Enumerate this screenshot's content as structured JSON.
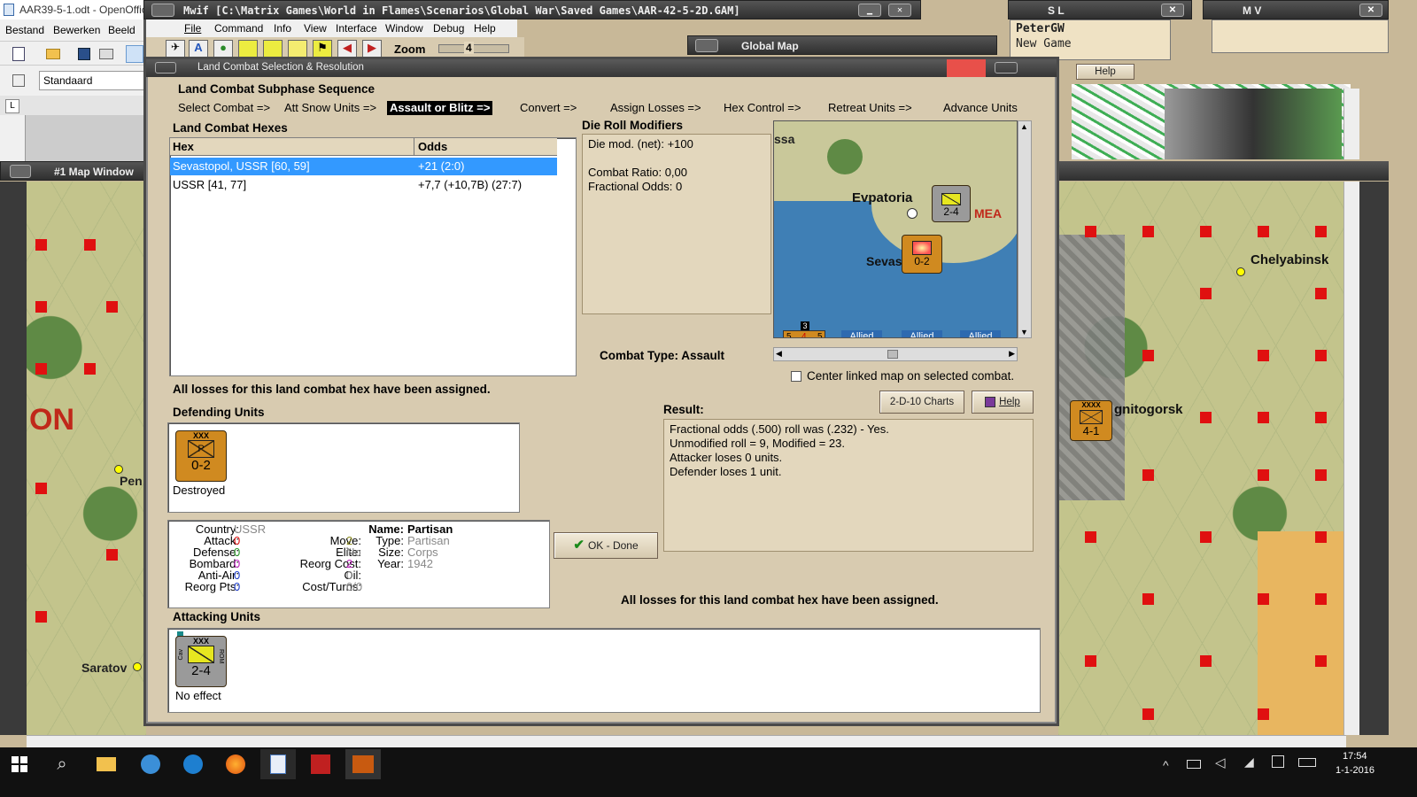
{
  "openoffice": {
    "title": "AAR39-5-1.odt - OpenOffic",
    "menu": [
      "Bestand",
      "Bewerken",
      "Beeld"
    ],
    "style_value": "Standaard"
  },
  "main_window": {
    "title": "Mwif [C:\\Matrix Games\\World in Flames\\Scenarios\\Global War\\Saved Games\\AAR-42-5-2D.GAM]",
    "menu": [
      "File",
      "Command",
      "Info",
      "View",
      "Interface",
      "Window",
      "Debug",
      "Help"
    ],
    "zoom_label": "Zoom",
    "zoom_value": "4"
  },
  "sl_window": {
    "title": "S L",
    "user": "PeterGW",
    "subtitle": "New Game"
  },
  "mv_window": {
    "title": "M V"
  },
  "global_map": {
    "title": "Global Map",
    "help_label": "Help"
  },
  "map_window": {
    "title": "#1 Map Window",
    "labels": [
      "ON",
      "Pen",
      "Saratov"
    ]
  },
  "right_map": {
    "labels": [
      "Chelyabinsk",
      "gnitogorsk"
    ],
    "counter_value": "4-1",
    "counter_size": "XXXX"
  },
  "dialog": {
    "title": "Land Combat Selection & Resolution",
    "sequence_title": "Land Combat Subphase Sequence",
    "sequence": [
      "Select Combat =>",
      "Att Snow Units =>",
      "Assault or Blitz =>",
      "Convert =>",
      "Assign Losses =>",
      "Hex Control =>",
      "Retreat Units =>",
      "Advance Units"
    ],
    "sequence_active": "Assault or Blitz =>",
    "hexes_title": "Land Combat Hexes",
    "hexes_columns": [
      "Hex",
      "Odds"
    ],
    "hexes_rows": [
      {
        "hex": "Sevastopol, USSR [60, 59]",
        "odds": "+21 (2:0)",
        "selected": true
      },
      {
        "hex": "USSR [41, 77]",
        "odds": "+7,7 (+10,7B) (27:7)",
        "selected": false
      }
    ],
    "drm_title": "Die Roll Modifiers",
    "drm_lines": [
      "Die mod. (net): +100",
      "",
      "Combat Ratio: 0,00",
      "Fractional Odds: 0"
    ],
    "minimap": {
      "labels": [
        "ssa",
        "Evpatoria",
        "MEA",
        "Sevas"
      ],
      "attacker_counter": "2-4",
      "defender_counter": "0-2",
      "stack_count": "3",
      "stack_values": [
        "5",
        "4",
        "5"
      ],
      "allied_tabs": [
        "Allied",
        "Allied",
        "Allied"
      ]
    },
    "combat_type_label": "Combat Type:",
    "combat_type_value": "Assault",
    "center_checkbox_label": "Center linked map on selected combat.",
    "losses_msg": "All losses for this land combat hex have been assigned.",
    "defending_title": "Defending Units",
    "defending_units": [
      {
        "size": "XXX",
        "symbol": "P",
        "value": "0-2",
        "status": "Destroyed"
      }
    ],
    "charts_button": "2-D-10 Charts",
    "help_button": "Help",
    "result_title": "Result:",
    "result_lines": [
      "Fractional odds (.500) roll was (.232)  - Yes.",
      "Unmodified roll = 9, Modified = 23.",
      "Attacker loses 0 units.",
      "Defender loses 1 unit."
    ],
    "unit_info": {
      "country_label": "Country:",
      "country": "USSR",
      "attack_label": "Attack:",
      "attack": "0",
      "defense_label": "Defense:",
      "defense": "0",
      "bombard_label": "Bombard:",
      "bombard": "0",
      "antiair_label": "Anti-Air:",
      "antiair": "0",
      "reorgpts_label": "Reorg Pts:",
      "reorgpts": "0",
      "move_label": "Move:",
      "move": "2",
      "elite_label": "Elite:",
      "elite": "No",
      "reorgcost_label": "Reorg Cost:",
      "reorgcost": "2",
      "oil_label": "Oil:",
      "oil": "0",
      "costturns_label": "Cost/Turns:",
      "costturns": "0/0",
      "name_label": "Name:",
      "name": "Partisan",
      "type_label": "Type:",
      "type": "Partisan",
      "size_label": "Size:",
      "size": "Corps",
      "year_label": "Year:",
      "year": "1942"
    },
    "ok_button": "OK - Done",
    "losses_msg2": "All losses for this land combat hex have been assigned.",
    "attacking_title": "Attacking Units",
    "attacking_units": [
      {
        "size": "XXX",
        "side_left": "Cav",
        "side_right": "ROM",
        "value": "2-4",
        "status": "No effect"
      }
    ]
  },
  "taskbar": {
    "time": "17:54",
    "date": "1-1-2016"
  },
  "colors": {
    "dialog_bg": "#d8cbb0",
    "selection": "#3399ff",
    "counter_orange": "#d08a20",
    "counter_grey": "#9a9a9a",
    "sea": "#3f7fb5",
    "red": "#e01010"
  }
}
